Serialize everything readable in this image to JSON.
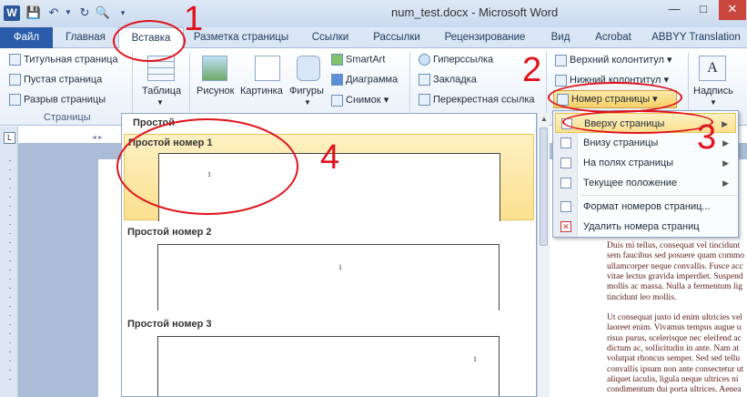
{
  "window": {
    "title": "num_test.docx - Microsoft Word",
    "app_letter": "W"
  },
  "tabs": [
    "Файл",
    "Главная",
    "Вставка",
    "Разметка страницы",
    "Ссылки",
    "Рассылки",
    "Рецензирование",
    "Вид",
    "Acrobat",
    "ABBYY Translation"
  ],
  "ribbon": {
    "pages_group": {
      "items": [
        "Титульная страница",
        "Пустая страница",
        "Разрыв страницы"
      ],
      "label": "Страницы"
    },
    "table": "Таблица",
    "illustrations": {
      "picture": "Рисунок",
      "clipart": "Картинка",
      "shapes": "Фигуры",
      "smartart": "SmartArt",
      "chart": "Диаграмма",
      "screenshot": "Снимок"
    },
    "links": {
      "hyperlink": "Гиперссылка",
      "bookmark": "Закладка",
      "crossref": "Перекрестная ссылка"
    },
    "header_footer": {
      "header": "Верхний колонтитул",
      "footer": "Нижний колонтитул",
      "page_number": "Номер страницы"
    },
    "textbox": "Надпись"
  },
  "gallery": {
    "section": "Простой",
    "items": [
      {
        "title": "Простой номер 1",
        "num": "1"
      },
      {
        "title": "Простой номер 2",
        "num": "1"
      },
      {
        "title": "Простой номер 3",
        "num": "1"
      }
    ]
  },
  "submenu": {
    "items": [
      {
        "label": "Вверху страницы"
      },
      {
        "label": "Внизу страницы"
      },
      {
        "label": "На полях страницы"
      },
      {
        "label": "Текущее положение"
      },
      {
        "label": "Формат номеров страниц..."
      },
      {
        "label": "Удалить номера страниц"
      }
    ]
  },
  "document": {
    "lines": [
      "Duis mi tellus, consequat vel tincidunt",
      "sem faucibus sed posuere quam commo",
      "ullamcorper neque convallis. Fusce acc",
      "vitae lectus gravida imperdiet. Suspend",
      "mollis ac massa. Nulla a fermentum lig",
      "tincidunt leo mollis.",
      "",
      "Ut consequat justo id enim ultricies vel",
      "laoreet enim. Vivamus tempus augue u",
      "risus purus, scelerisque nec eleifend ac",
      "dictum ac, sollicitudin in ante. Nam at",
      "volutpat rhoncus semper. Sed sed tellu",
      "convallis ipsum non ante consectetur ut",
      "aliquet iaculis, ligula neque ultrices ni",
      "condimentum dui porta ultrices. Aenea"
    ]
  },
  "annotations": [
    "1",
    "2",
    "3",
    "4"
  ],
  "colors": {
    "annotation_red": "#e0121a",
    "file_tab": "#2a5cab",
    "highlight": "#fbe08f"
  }
}
